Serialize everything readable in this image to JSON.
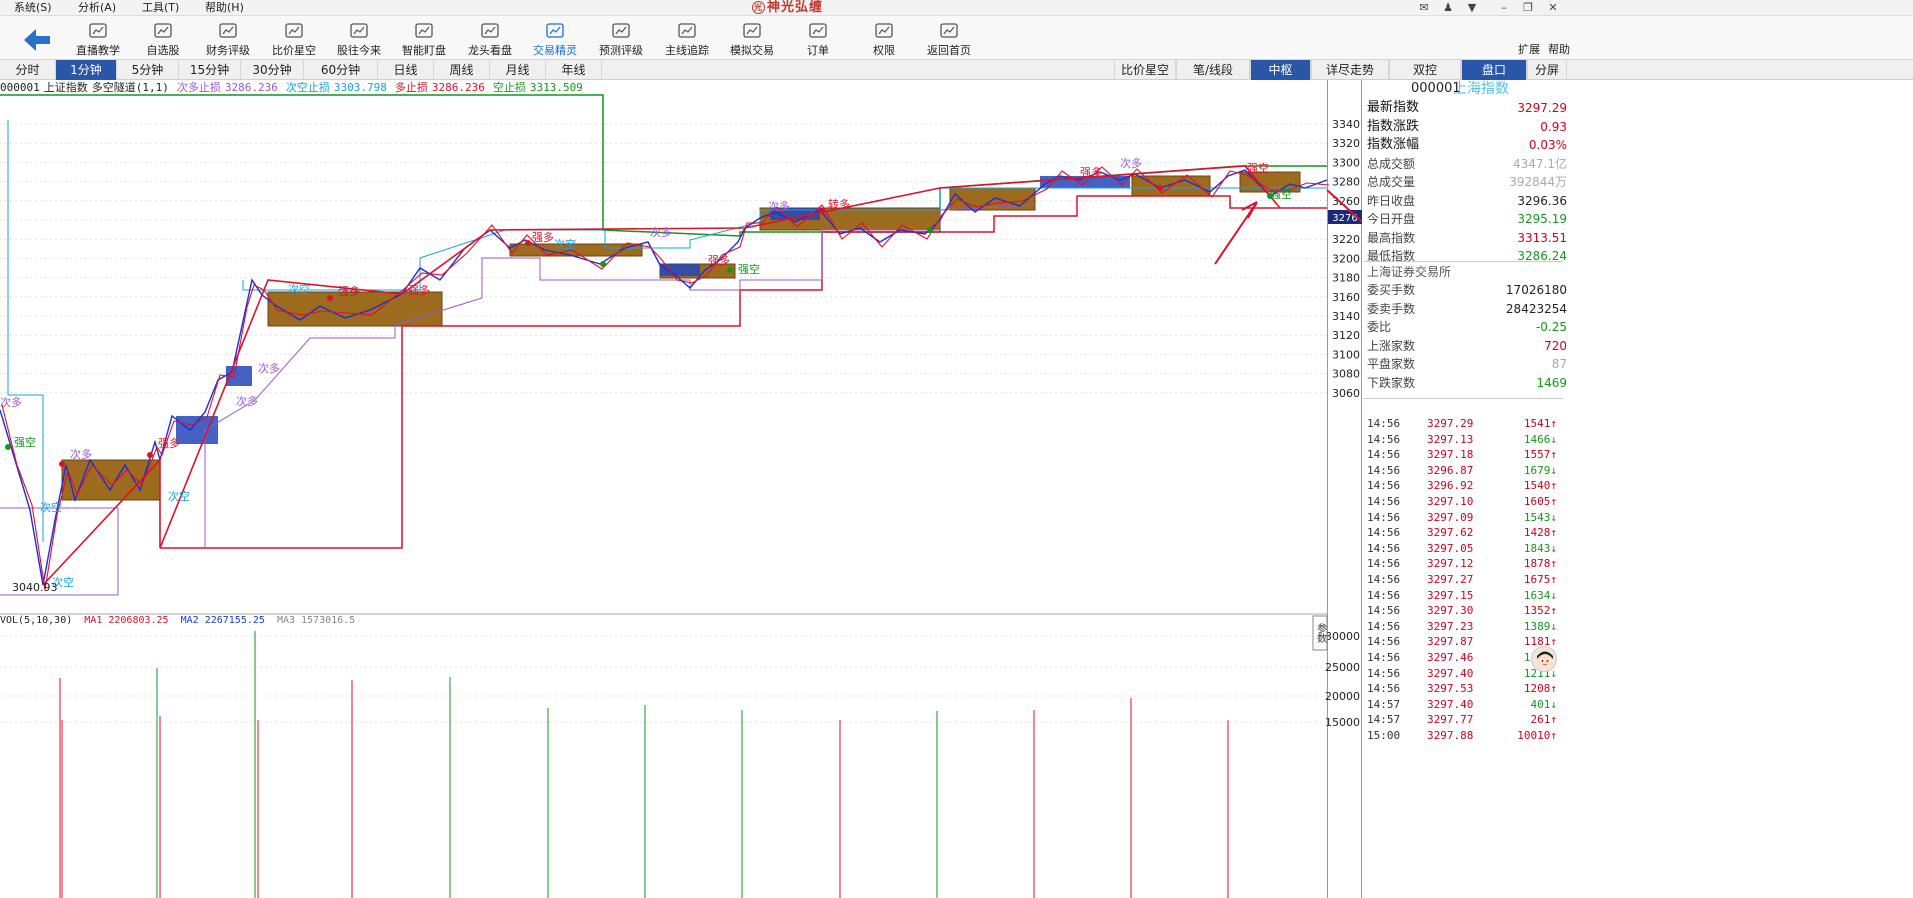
{
  "menu": [
    "系统(S)",
    "分析(A)",
    "工具(T)",
    "帮助(H)"
  ],
  "app_title": "神光弘缠",
  "app_logo_glyph": "光",
  "toolbar": {
    "items": [
      "直播教学",
      "自选股",
      "财务评级",
      "比价星空",
      "股往今来",
      "智能盯盘",
      "龙头看盘",
      "交易精灵",
      "预测评级",
      "主线追踪",
      "模拟交易",
      "订单",
      "权限",
      "返回首页"
    ],
    "active": "交易精灵",
    "right": [
      "扩展",
      "帮助"
    ]
  },
  "periods": [
    "分时",
    "1分钟",
    "5分钟",
    "15分钟",
    "30分钟",
    "60分钟",
    "日线",
    "周线",
    "月线",
    "年线"
  ],
  "active_period": "1分钟",
  "right_tabs": [
    "比价星空",
    "笔/线段",
    "中枢",
    "详尽走势",
    "双控",
    "盘口",
    "分屏"
  ],
  "active_right_tabs": [
    "中枢",
    "盘口"
  ],
  "indicator": {
    "code": "000001",
    "name": "上证指数",
    "formula": "多空隧道(1,1)",
    "items": [
      {
        "label": "次多止损",
        "value": "3286.236",
        "color": "#9b59d0"
      },
      {
        "label": "次空止损",
        "value": "3303.798",
        "color": "#1aa3d6"
      },
      {
        "label": "多止损",
        "value": "3286.236",
        "color": "#e0102a"
      },
      {
        "label": "空止损",
        "value": "3313.509",
        "color": "#14961e"
      }
    ]
  },
  "vol": {
    "label": "VOL(5,10,30)",
    "ma1": "MA1 2206803.25",
    "ma2": "MA2 2267155.25",
    "ma3": "MA3 1573016.5"
  },
  "price_axis": [
    "3340",
    "3320",
    "3300",
    "3280",
    "3260",
    "3240",
    "3220",
    "3200",
    "3180",
    "3160",
    "3140",
    "3120",
    "3100",
    "3080",
    "3060"
  ],
  "current_price_tag": "3276",
  "vol_axis": [
    "30000",
    "25000",
    "20000",
    "15000"
  ],
  "low_label": "3040.93",
  "annotations": [
    "次多",
    "强空",
    "次空",
    "次多",
    "次空",
    "强多",
    "次多",
    "次空",
    "强多",
    "次多",
    "强多",
    "次空",
    "次多",
    "强空",
    "强多",
    "转多",
    "次多",
    "强多",
    "强空",
    "次空",
    "强多",
    "强空",
    "次多"
  ],
  "side_button": "参数",
  "quote": {
    "code": "000001",
    "name": "上海指数",
    "rows": [
      {
        "label": "最新指数",
        "value": "3297.29",
        "color": "#d0021b",
        "big": true
      },
      {
        "label": "指数涨跌",
        "value": "0.93",
        "color": "#d0021b",
        "big": true
      },
      {
        "label": "指数涨幅",
        "value": "0.03%",
        "color": "#d0021b",
        "big": true
      },
      {
        "label": "总成交额",
        "value": "4347.1亿",
        "color": "#aaaaaa",
        "big": false
      },
      {
        "label": "总成交量",
        "value": "392844万",
        "color": "#aaaaaa",
        "big": false
      },
      {
        "label": "昨日收盘",
        "value": "3296.36",
        "color": "#222222",
        "big": false
      },
      {
        "label": "今日开盘",
        "value": "3295.19",
        "color": "#14961e",
        "big": false
      },
      {
        "label": "最高指数",
        "value": "3313.51",
        "color": "#d0021b",
        "big": false
      },
      {
        "label": "最低指数",
        "value": "3286.24",
        "color": "#14961e",
        "big": false
      }
    ],
    "exchange": "上海证券交易所",
    "rows2": [
      {
        "label": "委买手数",
        "value": "17026180",
        "color": "#222222"
      },
      {
        "label": "委卖手数",
        "value": "28423254",
        "color": "#222222"
      },
      {
        "label": "委比",
        "value": "-0.25",
        "color": "#14961e"
      },
      {
        "label": "上涨家数",
        "value": "720",
        "color": "#d0021b"
      },
      {
        "label": "平盘家数",
        "value": "87",
        "color": "#aaaaaa"
      },
      {
        "label": "下跌家数",
        "value": "1469",
        "color": "#14961e"
      }
    ]
  },
  "ticks": [
    {
      "time": "14:56",
      "price": "3297.29",
      "vol": "1541",
      "dir": "up"
    },
    {
      "time": "14:56",
      "price": "3297.13",
      "vol": "1466",
      "dir": "down"
    },
    {
      "time": "14:56",
      "price": "3297.18",
      "vol": "1557",
      "dir": "up"
    },
    {
      "time": "14:56",
      "price": "3296.87",
      "vol": "1679",
      "dir": "down"
    },
    {
      "time": "14:56",
      "price": "3296.92",
      "vol": "1540",
      "dir": "up"
    },
    {
      "time": "14:56",
      "price": "3297.10",
      "vol": "1605",
      "dir": "up"
    },
    {
      "time": "14:56",
      "price": "3297.09",
      "vol": "1543",
      "dir": "down"
    },
    {
      "time": "14:56",
      "price": "3297.62",
      "vol": "1428",
      "dir": "up"
    },
    {
      "time": "14:56",
      "price": "3297.05",
      "vol": "1843",
      "dir": "down"
    },
    {
      "time": "14:56",
      "price": "3297.12",
      "vol": "1878",
      "dir": "up"
    },
    {
      "time": "14:56",
      "price": "3297.27",
      "vol": "1675",
      "dir": "up"
    },
    {
      "time": "14:56",
      "price": "3297.15",
      "vol": "1634",
      "dir": "down"
    },
    {
      "time": "14:56",
      "price": "3297.30",
      "vol": "1352",
      "dir": "up"
    },
    {
      "time": "14:56",
      "price": "3297.23",
      "vol": "1389",
      "dir": "down"
    },
    {
      "time": "14:56",
      "price": "3297.87",
      "vol": "1181",
      "dir": "up"
    },
    {
      "time": "14:56",
      "price": "3297.46",
      "vol": "1132",
      "dir": "down"
    },
    {
      "time": "14:56",
      "price": "3297.40",
      "vol": "1211",
      "dir": "down"
    },
    {
      "time": "14:56",
      "price": "3297.53",
      "vol": "1208",
      "dir": "up"
    },
    {
      "time": "14:57",
      "price": "3297.40",
      "vol": "401",
      "dir": "down"
    },
    {
      "time": "14:57",
      "price": "3297.77",
      "vol": "261",
      "dir": "up"
    },
    {
      "time": "15:00",
      "price": "3297.88",
      "vol": "10010",
      "dir": "up"
    }
  ]
}
